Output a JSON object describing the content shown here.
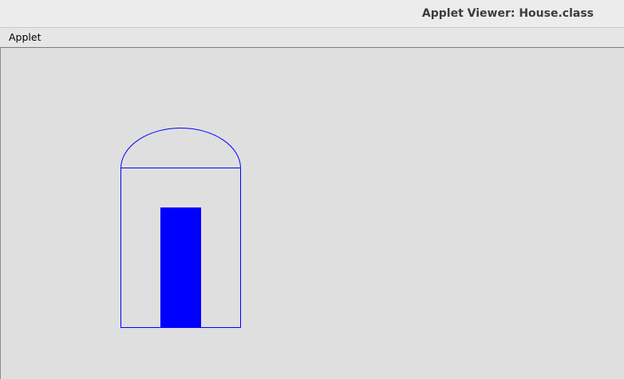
{
  "window": {
    "title": "Applet Viewer: House.class"
  },
  "menubar": {
    "items": [
      {
        "label": "Applet"
      }
    ]
  },
  "applet": {
    "drawing": "house",
    "stroke_color": "#0000ff",
    "fill_color": "#0000ff",
    "background_color": "#dfdfdf"
  }
}
